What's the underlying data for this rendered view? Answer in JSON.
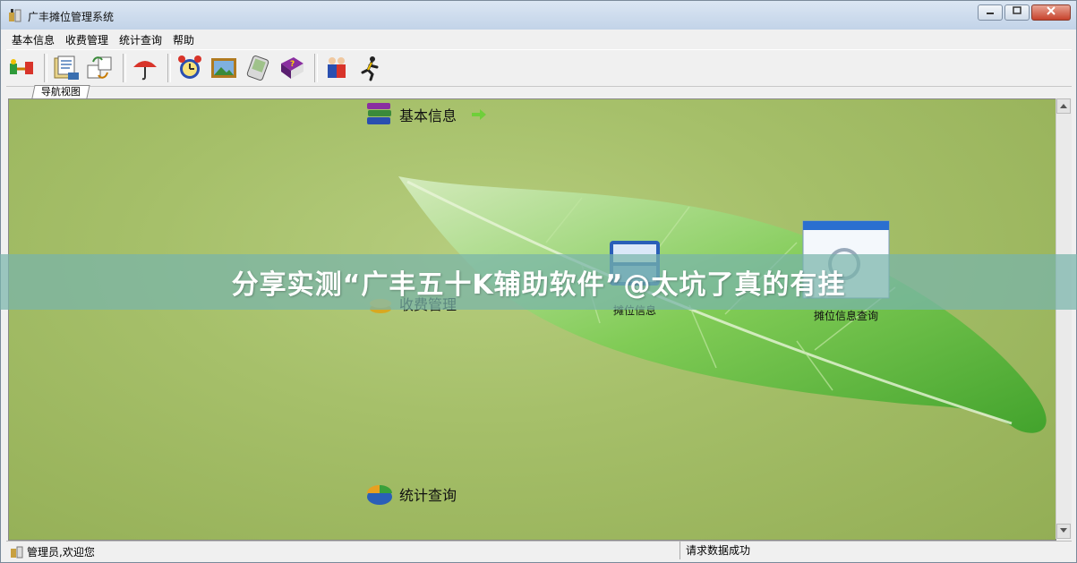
{
  "window": {
    "title": "广丰摊位管理系统"
  },
  "menu": {
    "items": [
      "基本信息",
      "收费管理",
      "统计查询",
      "帮助"
    ]
  },
  "tabs": {
    "nav_view": "导航视图"
  },
  "nav": {
    "basic_info": "基本信息",
    "fee_mgmt": "收费管理",
    "stats_query": "统计查询",
    "stall_info": "摊位信息",
    "stall_info_query": "摊位信息查询"
  },
  "banner": {
    "text": "分享实测“广丰五十K辅助软件”@太坑了真的有挂"
  },
  "status": {
    "user": "管理员,欢迎您",
    "message": "请求数据成功"
  },
  "colors": {
    "canvas_green": "#a6c06a",
    "leaf_green": "#5fb93a",
    "banner_overlay": "#78b4aa"
  }
}
